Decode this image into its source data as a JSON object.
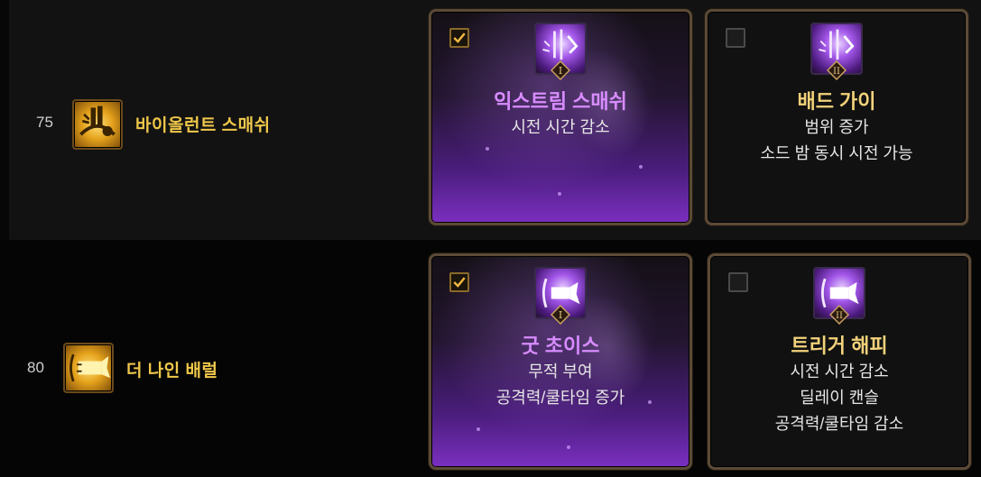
{
  "rows": [
    {
      "level": "75",
      "skill": {
        "name": "바이올런트 스매쉬",
        "icon": "violent-smash-icon"
      },
      "options": [
        {
          "selected": true,
          "rank": "I",
          "title": "익스트림 스매쉬",
          "effects": [
            "시전 시간 감소"
          ]
        },
        {
          "selected": false,
          "rank": "II",
          "title": "배드 가이",
          "effects": [
            "범위 증가",
            "소드 밤 동시 시전 가능"
          ]
        }
      ]
    },
    {
      "level": "80",
      "skill": {
        "name": "더 나인 배럴",
        "icon": "nine-barrel-icon"
      },
      "options": [
        {
          "selected": true,
          "rank": "I",
          "title": "굿 초이스",
          "effects": [
            "무적 부여",
            "공격력/쿨타임 증가"
          ]
        },
        {
          "selected": false,
          "rank": "II",
          "title": "트리거 해피",
          "effects": [
            "시전 시간 감소",
            "딜레이 캔슬",
            "공격력/쿨타임 감소"
          ]
        }
      ]
    }
  ],
  "colors": {
    "selected_title": "#d88cff",
    "unselected_title": "#f2d27a",
    "skill_name": "#f0c84a",
    "card_border": "#5b4a36"
  }
}
